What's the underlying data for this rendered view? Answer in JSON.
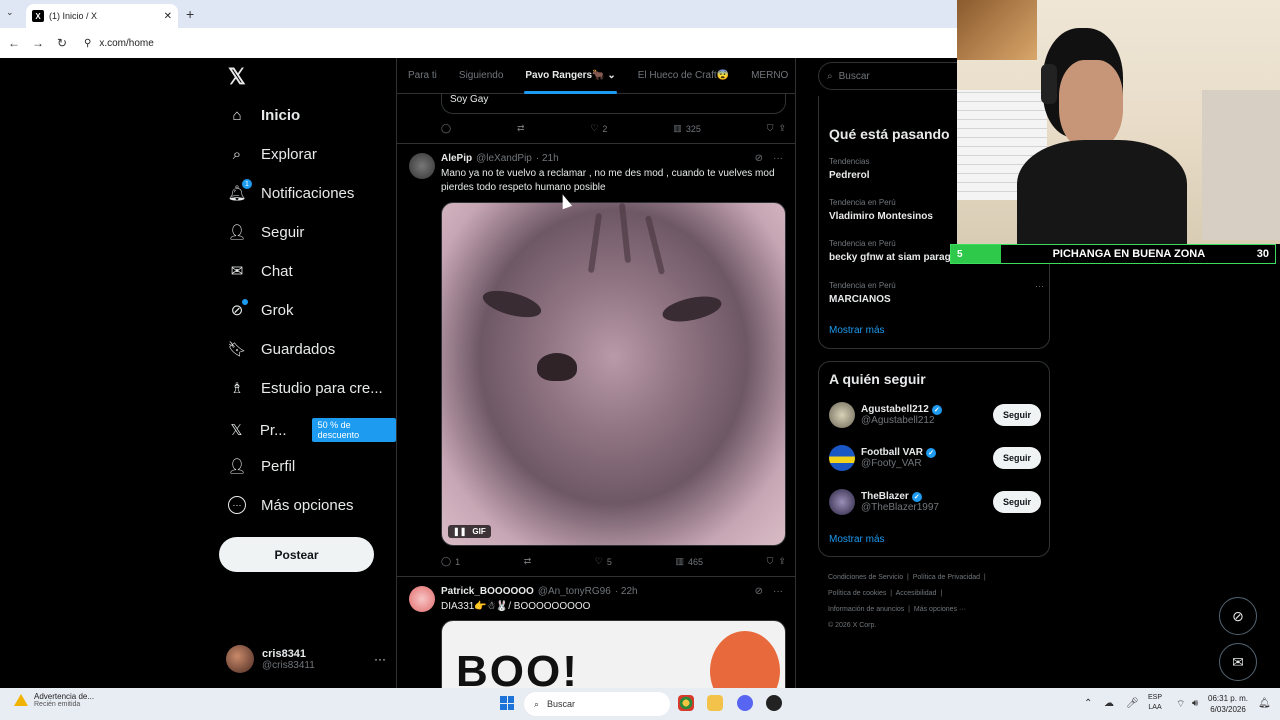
{
  "browser": {
    "tab_title": "(1) Inicio / X",
    "tab_close": "✕",
    "new_tab": "+",
    "tab_menu": "⌄",
    "url": "x.com/home",
    "back": "←",
    "forward": "→",
    "reload": "↻"
  },
  "nav": {
    "logo": "𝕏",
    "items": [
      {
        "label": "Inicio",
        "icon": "home-icon",
        "glyph": "⌂"
      },
      {
        "label": "Explorar",
        "icon": "search-icon",
        "glyph": "⌕"
      },
      {
        "label": "Notificaciones",
        "icon": "bell-icon",
        "glyph": "♫",
        "badge": "1"
      },
      {
        "label": "Seguir",
        "icon": "person-add-icon",
        "glyph": "⍤"
      },
      {
        "label": "Chat",
        "icon": "mail-icon",
        "glyph": "✉"
      },
      {
        "label": "Grok",
        "icon": "grok-icon",
        "glyph": "⊘"
      },
      {
        "label": "Guardados",
        "icon": "bookmark-icon",
        "glyph": "⛉"
      },
      {
        "label": "Estudio para cre...",
        "icon": "studio-icon",
        "glyph": "♗"
      },
      {
        "label": "Pr...",
        "icon": "x-premium-icon",
        "glyph": "𝕏",
        "pill": "50 % de descuento"
      },
      {
        "label": "Perfil",
        "icon": "profile-icon",
        "glyph": "☺"
      },
      {
        "label": "Más opciones",
        "icon": "more-circle-icon",
        "glyph": "⋯"
      }
    ],
    "post_button": "Postear",
    "profile_name": "cris8341",
    "profile_handle": "@cris83411",
    "profile_more": "···"
  },
  "timeline": {
    "tabs": [
      "Para ti",
      "Siguiendo",
      "Pavo Rangers🐂 ⌄",
      "El Hueco de Craft😨",
      "MERNO"
    ],
    "active_tab": 2,
    "prev_quote_text": "Soy Gay",
    "prev_actions": {
      "reply": "",
      "retweet": "",
      "like": "2",
      "views": "325"
    },
    "tweet1": {
      "name": "AlePip",
      "handle": "@leXandPip",
      "time": "· 21h",
      "text": "Mano ya no te vuelvo a reclamar , no me des mod , cuando te vuelves mod pierdes todo respeto humano posible",
      "gif_label": "GIF",
      "pause": "❚❚",
      "actions": {
        "reply": "1",
        "retweet": "",
        "like": "5",
        "views": "465"
      }
    },
    "tweet2": {
      "name": "Patrick_BOOOOOO",
      "handle": "@An_tonyRG96",
      "time": "· 22h",
      "text": "DIA331👉☃🐰/ BOOOOOOOOO",
      "media_text": "BOO!"
    }
  },
  "sidebar": {
    "search_placeholder": "Buscar",
    "trends_title": "Qué está pasando",
    "trends": [
      {
        "context": "Tendencias",
        "topic": "Pedrerol"
      },
      {
        "context": "Tendencia en Perú",
        "topic": "Vladimiro Montesinos"
      },
      {
        "context": "Tendencia en Perú",
        "topic": "becky gfnw at siam paragon"
      },
      {
        "context": "Tendencia en Perú",
        "topic": "MARCIANOS"
      }
    ],
    "trend_more": "···",
    "show_more": "Mostrar más",
    "follow_title": "A quién seguir",
    "follow": [
      {
        "name": "Agustabell212",
        "handle": "@Agustabell212",
        "button": "Seguir"
      },
      {
        "name": "Football VAR",
        "handle": "@Footy_VAR",
        "button": "Seguir"
      },
      {
        "name": "TheBlazer",
        "handle": "@TheBlazer1997",
        "button": "Seguir"
      }
    ],
    "follow_show_more": "Mostrar más",
    "footer": [
      "Condiciones de Servicio",
      "Política de Privacidad",
      "Política de cookies",
      "Accesibilidad",
      "Información de anuncios",
      "Más opciones ···",
      "© 2026 X Corp."
    ]
  },
  "overlay": {
    "banner_left": "5",
    "banner_text": "PICHANGA EN BUENA ZONA",
    "banner_right": "30"
  },
  "taskbar": {
    "warning_title": "Advertencia de...",
    "warning_sub": "Recién emitida",
    "search": "Buscar",
    "lang1": "ESP",
    "lang2": "LAA",
    "time": "06:31 p. m.",
    "date": "6/03/2026"
  },
  "colors": {
    "accent": "#1d9bf0",
    "banner_green": "#2ec84a"
  }
}
